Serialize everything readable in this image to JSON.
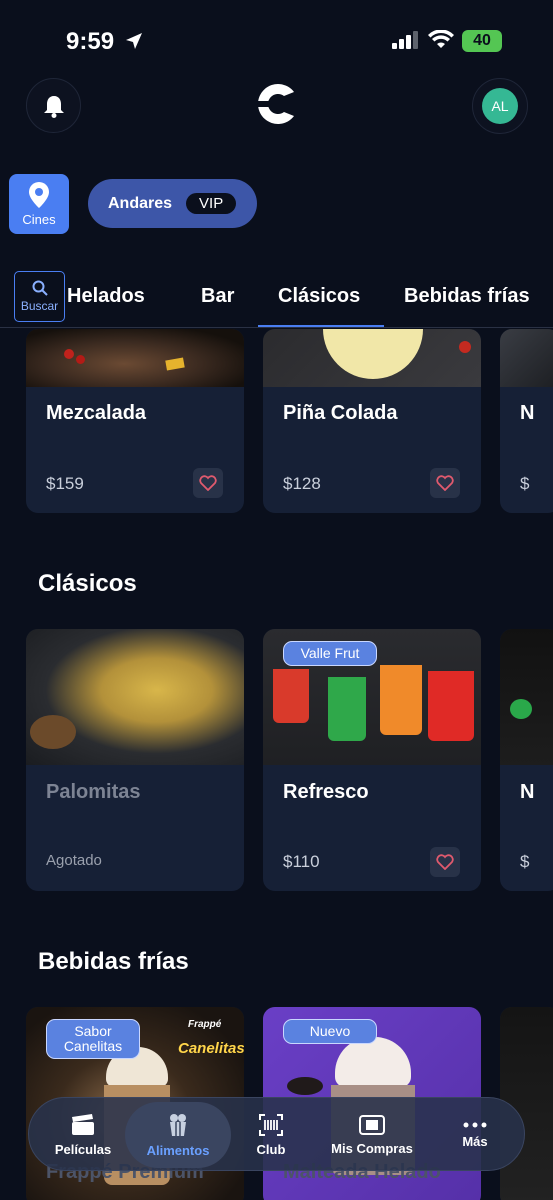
{
  "status_bar": {
    "time": "9:59",
    "battery": "40"
  },
  "header": {
    "avatar_initials": "AL"
  },
  "location": {
    "cines_label": "Cines",
    "theater": "Andares",
    "vip_label": "VIP"
  },
  "search": {
    "label": "Buscar"
  },
  "tabs": [
    {
      "label": "Helados"
    },
    {
      "label": "Bar"
    },
    {
      "label": "Clásicos"
    },
    {
      "label": "Bebidas frías"
    }
  ],
  "bar_row": {
    "items": [
      {
        "name": "Mezcalada",
        "price": "$159"
      },
      {
        "name": "Piña Colada",
        "price": "$128"
      },
      {
        "name": "N",
        "price": "$"
      }
    ]
  },
  "clasicos": {
    "title": "Clásicos",
    "items": [
      {
        "name": "Palomitas",
        "status": "Agotado"
      },
      {
        "name": "Refresco",
        "price": "$110",
        "tag": "Valle Frut"
      },
      {
        "name": "N",
        "price": "$"
      }
    ]
  },
  "bebidas_frias": {
    "title": "Bebidas frías",
    "items": [
      {
        "name": "Frappé Premium",
        "tag": "Sabor Canelitas",
        "brand_top": "Frappé",
        "brand": "Canelitas"
      },
      {
        "name": "Malteada Helado",
        "tag": "Nuevo"
      }
    ]
  },
  "bottom_nav": [
    {
      "label": "Películas",
      "icon": "clapperboard-icon"
    },
    {
      "label": "Alimentos",
      "icon": "popcorn-icon",
      "active": true
    },
    {
      "label": "Club",
      "icon": "barcode-scan-icon"
    },
    {
      "label": "Mis Compras",
      "icon": "ticket-icon"
    },
    {
      "label": "Más",
      "icon": "more-dots-icon"
    }
  ],
  "colors": {
    "background": "#0a0f1c",
    "card": "#162036",
    "accent": "#4a7ef2",
    "vip_pill": "#3d56a8",
    "avatar": "#35b894",
    "battery": "#54c653"
  }
}
